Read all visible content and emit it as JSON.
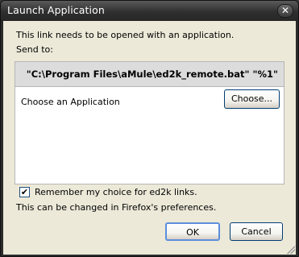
{
  "window": {
    "title": "Launch Application",
    "close_glyph": "✕"
  },
  "dialog": {
    "message": "This link needs to be opened with an application.",
    "send_to_label": "Send to:",
    "command_path": "\"C:\\Program Files\\aMule\\ed2k_remote.bat\" \"%1\"",
    "choose_application_label": "Choose an Application",
    "choose_button_label": "Choose...",
    "remember_label": "Remember my choice for ed2k links.",
    "remember_checked": true,
    "check_glyph": "✔",
    "preferences_note": "This can be changed in Firefox's preferences.",
    "ok_label": "OK",
    "cancel_label": "Cancel"
  },
  "colors": {
    "titlebar": "#2f2f2f",
    "client_bg": "#ece9d8",
    "button_border": "#003c74",
    "default_button_focus": "#5b8edc"
  }
}
